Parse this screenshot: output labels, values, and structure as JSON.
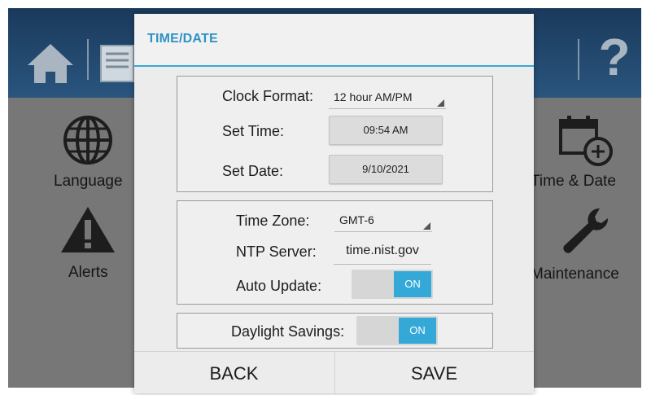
{
  "background": {
    "tiles": {
      "language": "Language",
      "alerts": "Alerts",
      "time_date": "Time & Date",
      "maintenance": "Maintenance"
    },
    "help_label": "?"
  },
  "dialog": {
    "title": "TIME/DATE",
    "clock_format": {
      "label": "Clock Format:",
      "value": "12 hour AM/PM"
    },
    "set_time": {
      "label": "Set Time:",
      "value": "09:54 AM"
    },
    "set_date": {
      "label": "Set Date:",
      "value": "9/10/2021"
    },
    "time_zone": {
      "label": "Time Zone:",
      "value": "GMT-6"
    },
    "ntp_server": {
      "label": "NTP Server:",
      "value": "time.nist.gov"
    },
    "auto_update": {
      "label": "Auto Update:",
      "state": "ON"
    },
    "daylight_savings": {
      "label": "Daylight Savings:",
      "state": "ON"
    },
    "back_label": "BACK",
    "save_label": "SAVE"
  },
  "colors": {
    "accent": "#34a9d8",
    "title": "#2f92c6"
  }
}
